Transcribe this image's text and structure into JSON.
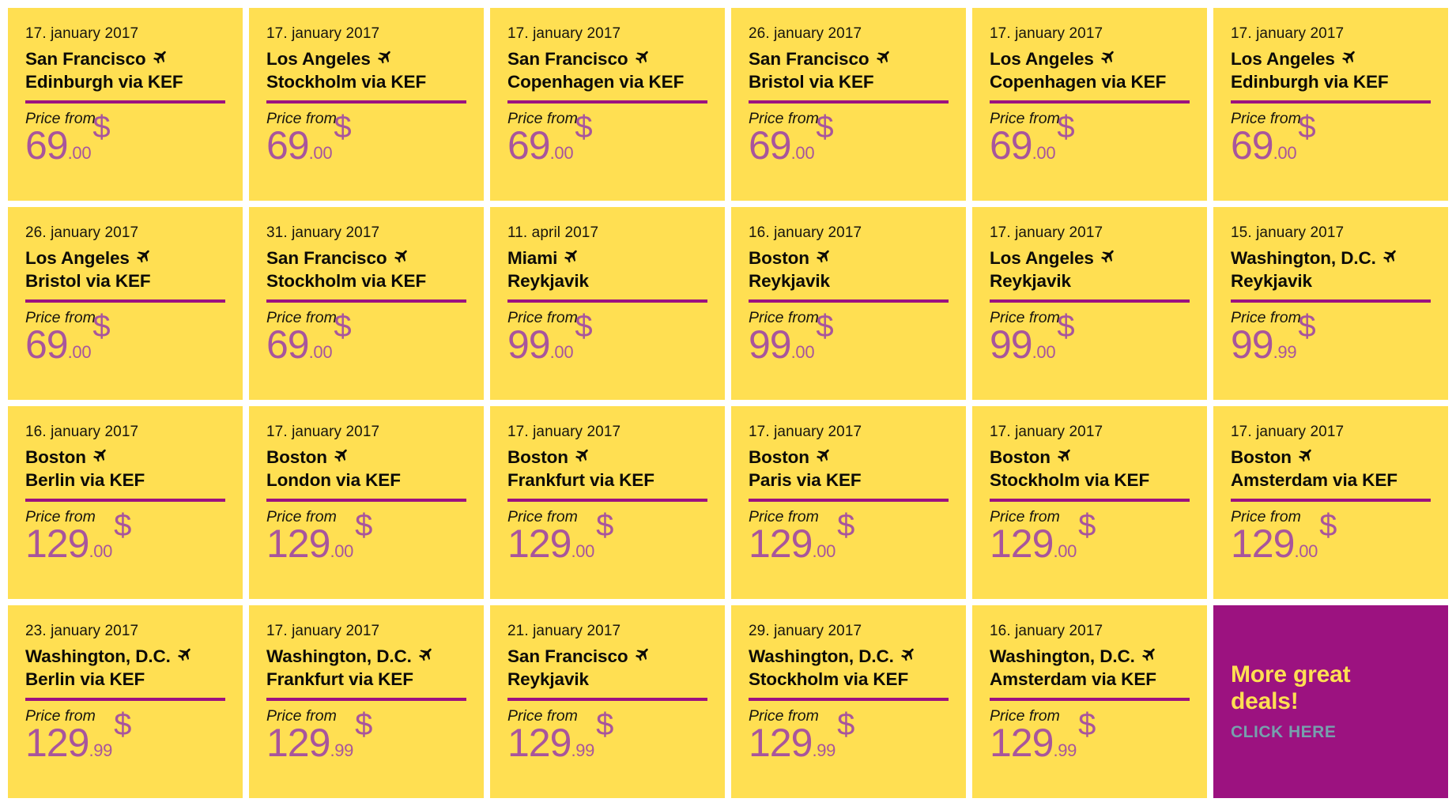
{
  "theme": {
    "card_bg": "#ffdf52",
    "page_bg": "#ffffff",
    "divider": "#9c1280",
    "price": "#a8559c",
    "text": "#17140d",
    "promo_bg": "#9c1280",
    "promo_title": "#ffdf52",
    "promo_cta": "#76a0ad"
  },
  "labels": {
    "price_from": "Price from",
    "plane_icon": "plane-icon"
  },
  "deals": [
    {
      "date": "17. january 2017",
      "origin": "San Francisco",
      "destination": "Edinburgh via KEF",
      "price_label": "Price from",
      "price_main": "69",
      "price_cents": ".00",
      "currency": "$"
    },
    {
      "date": "17. january 2017",
      "origin": "Los Angeles",
      "destination": "Stockholm via KEF",
      "price_label": "Price from",
      "price_main": "69",
      "price_cents": ".00",
      "currency": "$"
    },
    {
      "date": "17. january 2017",
      "origin": "San Francisco",
      "destination": "Copenhagen via KEF",
      "price_label": "Price from",
      "price_main": "69",
      "price_cents": ".00",
      "currency": "$"
    },
    {
      "date": "26. january 2017",
      "origin": "San Francisco",
      "destination": "Bristol via KEF",
      "price_label": "Price from",
      "price_main": "69",
      "price_cents": ".00",
      "currency": "$"
    },
    {
      "date": "17. january 2017",
      "origin": "Los Angeles",
      "destination": "Copenhagen via KEF",
      "price_label": "Price from",
      "price_main": "69",
      "price_cents": ".00",
      "currency": "$"
    },
    {
      "date": "17. january 2017",
      "origin": "Los Angeles",
      "destination": "Edinburgh via KEF",
      "price_label": "Price from",
      "price_main": "69",
      "price_cents": ".00",
      "currency": "$"
    },
    {
      "date": "26. january 2017",
      "origin": "Los Angeles",
      "destination": "Bristol via KEF",
      "price_label": "Price from",
      "price_main": "69",
      "price_cents": ".00",
      "currency": "$"
    },
    {
      "date": "31. january 2017",
      "origin": "San Francisco",
      "destination": "Stockholm via KEF",
      "price_label": "Price from",
      "price_main": "69",
      "price_cents": ".00",
      "currency": "$"
    },
    {
      "date": "11. april 2017",
      "origin": "Miami",
      "destination": "Reykjavik",
      "price_label": "Price from",
      "price_main": "99",
      "price_cents": ".00",
      "currency": "$"
    },
    {
      "date": "16. january 2017",
      "origin": "Boston",
      "destination": "Reykjavik",
      "price_label": "Price from",
      "price_main": "99",
      "price_cents": ".00",
      "currency": "$"
    },
    {
      "date": "17. january 2017",
      "origin": "Los Angeles",
      "destination": "Reykjavik",
      "price_label": "Price from",
      "price_main": "99",
      "price_cents": ".00",
      "currency": "$"
    },
    {
      "date": "15. january 2017",
      "origin": "Washington, D.C.",
      "destination": "Reykjavik",
      "price_label": "Price from",
      "price_main": "99",
      "price_cents": ".99",
      "currency": "$"
    },
    {
      "date": "16. january 2017",
      "origin": "Boston",
      "destination": "Berlin via KEF",
      "price_label": "Price from",
      "price_main": "129",
      "price_cents": ".00",
      "currency": "$"
    },
    {
      "date": "17. january 2017",
      "origin": "Boston",
      "destination": "London via KEF",
      "price_label": "Price from",
      "price_main": "129",
      "price_cents": ".00",
      "currency": "$"
    },
    {
      "date": "17. january 2017",
      "origin": "Boston",
      "destination": "Frankfurt via KEF",
      "price_label": "Price from",
      "price_main": "129",
      "price_cents": ".00",
      "currency": "$"
    },
    {
      "date": "17. january 2017",
      "origin": "Boston",
      "destination": "Paris via KEF",
      "price_label": "Price from",
      "price_main": "129",
      "price_cents": ".00",
      "currency": "$"
    },
    {
      "date": "17. january 2017",
      "origin": "Boston",
      "destination": "Stockholm via KEF",
      "price_label": "Price from",
      "price_main": "129",
      "price_cents": ".00",
      "currency": "$"
    },
    {
      "date": "17. january 2017",
      "origin": "Boston",
      "destination": "Amsterdam via KEF",
      "price_label": "Price from",
      "price_main": "129",
      "price_cents": ".00",
      "currency": "$"
    },
    {
      "date": "23. january 2017",
      "origin": "Washington, D.C.",
      "destination": "Berlin via KEF",
      "price_label": "Price from",
      "price_main": "129",
      "price_cents": ".99",
      "currency": "$"
    },
    {
      "date": "17. january 2017",
      "origin": "Washington, D.C.",
      "destination": "Frankfurt via KEF",
      "price_label": "Price from",
      "price_main": "129",
      "price_cents": ".99",
      "currency": "$"
    },
    {
      "date": "21. january 2017",
      "origin": "San Francisco",
      "destination": "Reykjavik",
      "price_label": "Price from",
      "price_main": "129",
      "price_cents": ".99",
      "currency": "$"
    },
    {
      "date": "29. january 2017",
      "origin": "Washington, D.C.",
      "destination": "Stockholm via KEF",
      "price_label": "Price from",
      "price_main": "129",
      "price_cents": ".99",
      "currency": "$"
    },
    {
      "date": "16. january 2017",
      "origin": "Washington, D.C.",
      "destination": "Amsterdam via KEF",
      "price_label": "Price from",
      "price_main": "129",
      "price_cents": ".99",
      "currency": "$"
    }
  ],
  "promo": {
    "title": "More great deals!",
    "cta": "CLICK HERE"
  }
}
